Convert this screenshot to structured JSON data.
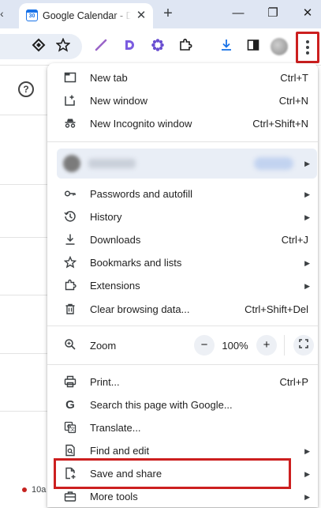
{
  "tab": {
    "title": "Google Calendar - D",
    "favicon_text": "30",
    "close": "✕"
  },
  "tabstrip": {
    "new_tab": "+",
    "scroll_left": "‹"
  },
  "window_controls": {
    "minimize": "—",
    "restore": "❐",
    "close": "✕"
  },
  "toolbar_icons": [
    "lens-icon",
    "star-icon",
    "pen-extension-icon",
    "d-extension-icon",
    "flower-extension-icon",
    "extensions-icon",
    "download-icon",
    "side-panel-icon",
    "profile-avatar",
    "menu-icon"
  ],
  "page": {
    "help_icon": "?",
    "event_text": "10a"
  },
  "menu": {
    "group1": [
      {
        "label": "New tab",
        "shortcut": "Ctrl+T",
        "icon": "new-tab-icon"
      },
      {
        "label": "New window",
        "shortcut": "Ctrl+N",
        "icon": "new-window-icon"
      },
      {
        "label": "New Incognito window",
        "shortcut": "Ctrl+Shift+N",
        "icon": "incognito-icon"
      }
    ],
    "group2": [
      {
        "label": "Passwords and autofill",
        "icon": "key-icon"
      },
      {
        "label": "History",
        "icon": "history-icon"
      },
      {
        "label": "Downloads",
        "shortcut": "Ctrl+J",
        "icon": "download-icon"
      },
      {
        "label": "Bookmarks and lists",
        "icon": "star-icon"
      },
      {
        "label": "Extensions",
        "icon": "extensions-icon"
      },
      {
        "label": "Clear browsing data...",
        "shortcut": "Ctrl+Shift+Del",
        "icon": "trash-icon"
      }
    ],
    "zoom": {
      "label": "Zoom",
      "minus": "−",
      "value": "100%",
      "plus": "+",
      "fullscreen_icon": "fullscreen-icon"
    },
    "group3": [
      {
        "label": "Print...",
        "shortcut": "Ctrl+P",
        "icon": "print-icon"
      },
      {
        "label": "Search this page with Google...",
        "icon": "google-icon"
      },
      {
        "label": "Translate...",
        "icon": "translate-icon"
      },
      {
        "label": "Find and edit",
        "icon": "find-icon"
      },
      {
        "label": "Save and share",
        "icon": "save-share-icon"
      },
      {
        "label": "More tools",
        "icon": "toolbox-icon"
      }
    ]
  },
  "colors": {
    "highlight": "#cc1f1f",
    "tabstrip": "#dfe6f3",
    "omnibox": "#e9eef6"
  }
}
